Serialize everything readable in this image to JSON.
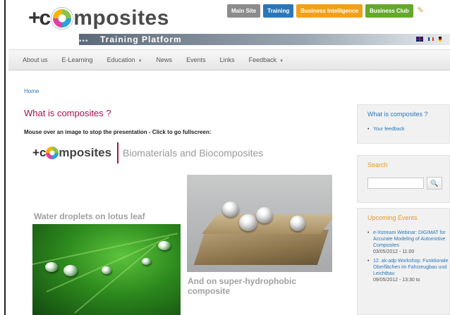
{
  "header": {
    "logo": {
      "plus": "+",
      "c": "c",
      "rest": "mposites"
    },
    "platform_label": "Training Platform",
    "platform_dots": "•••",
    "buttons": [
      {
        "label": "Main Site",
        "color": "#8c8c8c"
      },
      {
        "label": "Training",
        "color": "#2a76b8"
      },
      {
        "label": "Business Intelligence",
        "color": "#f0a01c"
      },
      {
        "label": "Business Club",
        "color": "#64a82c"
      }
    ],
    "pencil_glyph": "✎",
    "flags": [
      "uk-flag-icon",
      "fr-flag-icon",
      "de-flag-icon"
    ]
  },
  "nav": {
    "items": [
      {
        "label": "About us",
        "dropdown": false
      },
      {
        "label": "E-Learning",
        "dropdown": false
      },
      {
        "label": "Education",
        "dropdown": true
      },
      {
        "label": "News",
        "dropdown": false
      },
      {
        "label": "Events",
        "dropdown": false
      },
      {
        "label": "Links",
        "dropdown": false
      },
      {
        "label": "Feedback",
        "dropdown": true
      }
    ],
    "caret": "▼"
  },
  "main": {
    "breadcrumb": "Home",
    "title": "What is composites ?",
    "instruction": "Mouse over an image to stop the presentation - Click to go fullscreen:",
    "banner": {
      "plus": "+",
      "c": "c",
      "rest": "mposites",
      "subtitle": "Biomaterials and Biocomposites"
    },
    "slides": [
      {
        "caption": "Water droplets on lotus leaf"
      },
      {
        "caption": "And on super-hydrophobic composite"
      }
    ]
  },
  "sidebar": {
    "what": {
      "title": "What is composites ?",
      "items": [
        "Your feedback"
      ]
    },
    "search": {
      "title": "Search",
      "placeholder": "",
      "button_icon": "🔍"
    },
    "events": {
      "title": "Upcoming Events",
      "items": [
        {
          "text": "e-Xstream Webinar: DIGIMAT for Accurate Modeling of Automotive Composites",
          "date": "03/05/2012 - 11:00"
        },
        {
          "text": "12. ak-adp Workshop: Funktionale Oberflächen im Fahrzeugbau und Leichtbau",
          "date": "09/05/2012 - 13:30 to"
        }
      ]
    }
  },
  "colors": {
    "accent_blue": "#2a76b8",
    "title_magenta": "#a4124f",
    "events_orange": "#e89a1f"
  }
}
